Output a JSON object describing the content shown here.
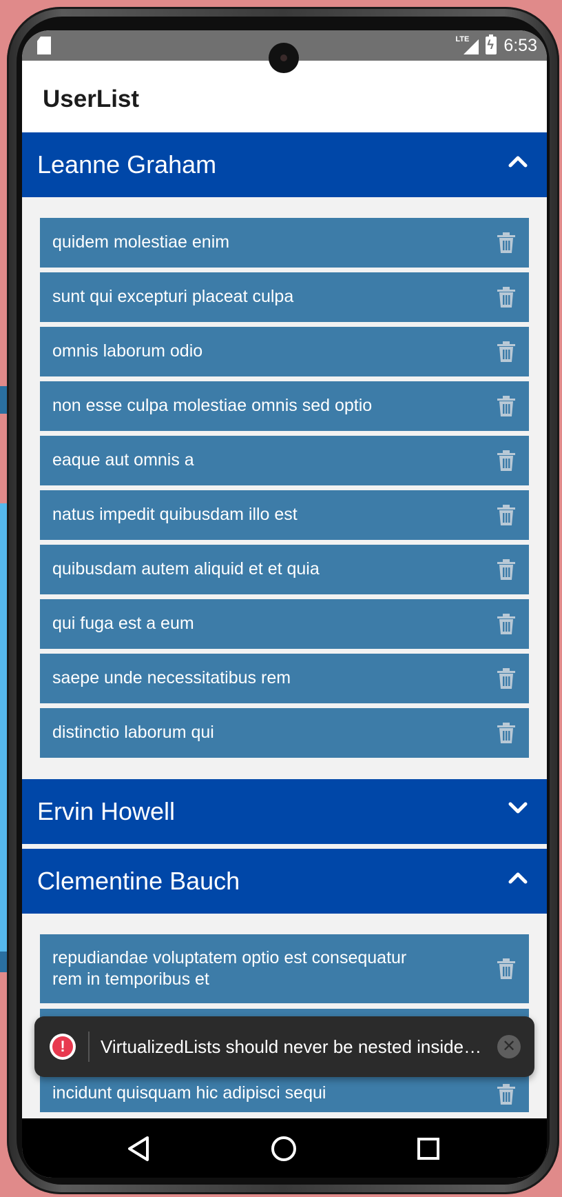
{
  "status_bar": {
    "time": "6:53",
    "network_label": "LTE",
    "sd_icon": "sd-card-icon",
    "signal_icon": "signal-icon",
    "battery_icon": "battery-charging-icon"
  },
  "app_bar": {
    "title": "UserList"
  },
  "sections": [
    {
      "name": "Leanne Graham",
      "expanded": true,
      "chevron_icon": "chevron-up-icon",
      "items": [
        "quidem molestiae enim",
        "sunt qui excepturi placeat culpa",
        "omnis laborum odio",
        "non esse culpa molestiae omnis sed optio",
        "eaque aut omnis a",
        "natus impedit quibusdam illo est",
        "quibusdam autem aliquid et et quia",
        "qui fuga est a eum",
        "saepe unde necessitatibus rem",
        "distinctio laborum qui"
      ]
    },
    {
      "name": "Ervin Howell",
      "expanded": false,
      "chevron_icon": "chevron-down-icon",
      "items": []
    },
    {
      "name": "Clementine Bauch",
      "expanded": true,
      "chevron_icon": "chevron-up-icon",
      "items": [
        "repudiandae voluptatem optio est consequatur rem in temporibus et",
        "incidunt quisquam hic adipisci sequi"
      ]
    }
  ],
  "toast": {
    "message": "VirtualizedLists should never be nested inside …",
    "icon": "error-icon",
    "close_icon": "close-icon"
  },
  "nav_bar": {
    "back_icon": "back-icon",
    "home_icon": "home-icon",
    "recent_icon": "recent-apps-icon"
  },
  "colors": {
    "section_header": "#0047a8",
    "item_background": "#3d7ca8",
    "list_background": "#f2f2f2",
    "toast_background": "#2b2b2b",
    "error_red": "#e8394f"
  }
}
